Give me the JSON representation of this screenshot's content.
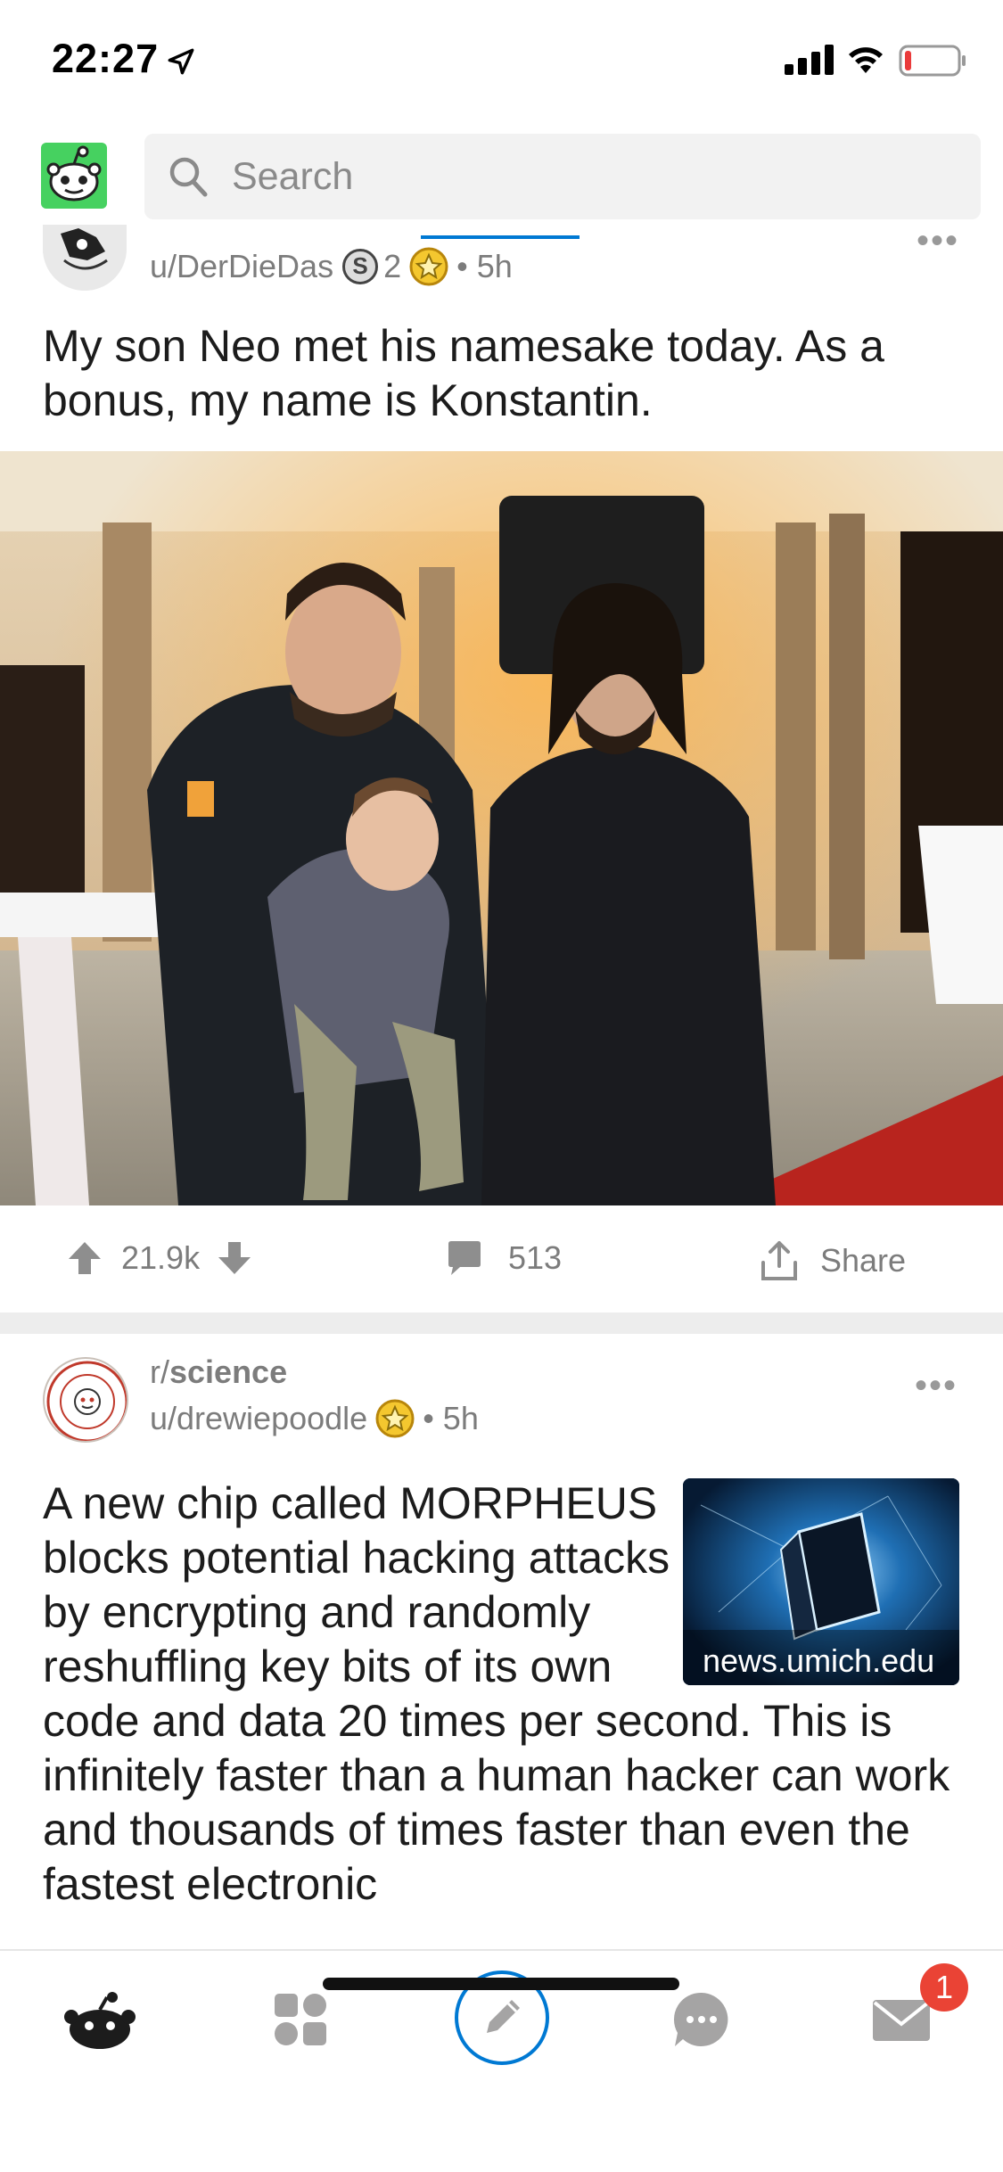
{
  "status": {
    "time": "22:27"
  },
  "search": {
    "placeholder": "Search"
  },
  "post1": {
    "author": "u/DerDieDas",
    "coin_count": "2",
    "coin_symbol": "S",
    "age": "• 5h",
    "title": "My son Neo met his namesake today. As a bonus, my name is Konstantin.",
    "upvotes": "21.9k",
    "comments": "513",
    "share_label": "Share"
  },
  "post2": {
    "subreddit_prefix": "r/",
    "subreddit_name": "science",
    "author": "u/drewiepoodle",
    "age": "• 5h",
    "title": "A new chip called MORPHEUS blocks potential hacking attacks by encrypting and randomly reshuffling key bits of its own code and data 20 times per second. This is infinitely faster than a human hacker can work and thousands of times faster than even the fastest electronic",
    "link_domain": "news.umich.edu"
  },
  "nav": {
    "inbox_badge": "1"
  },
  "colors": {
    "accent": "#0079d3",
    "badge": "#ea4335",
    "icon_gray": "#a5a4a4"
  }
}
